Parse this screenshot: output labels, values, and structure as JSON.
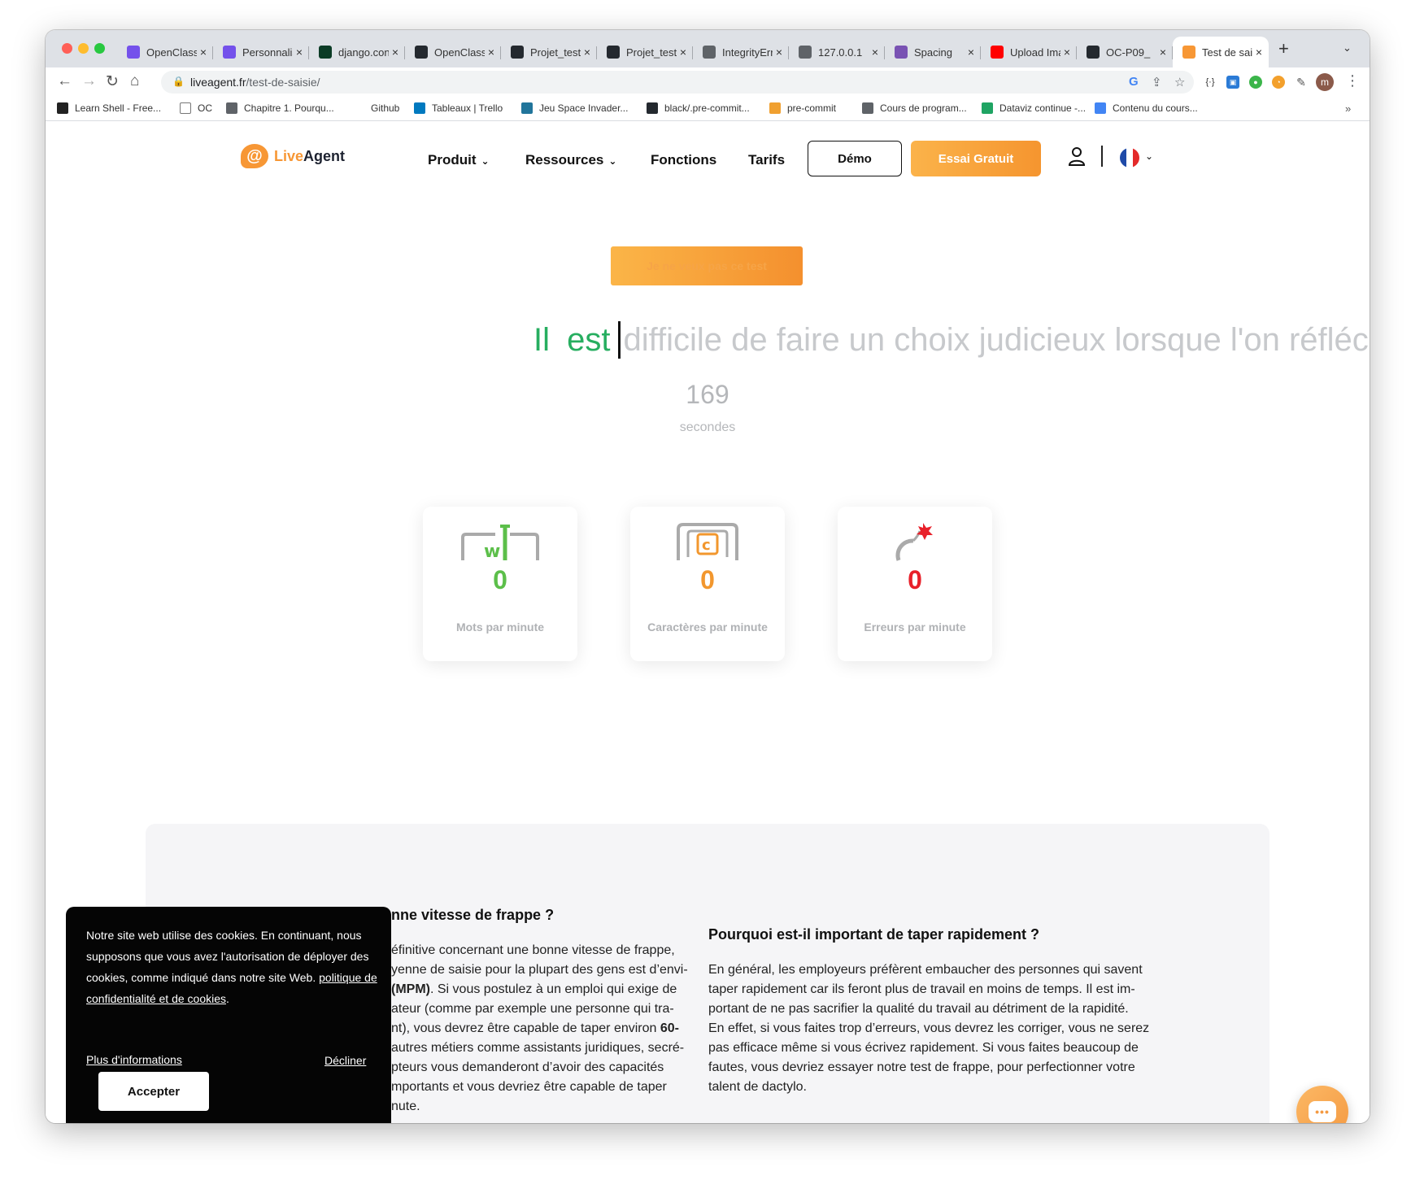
{
  "browser": {
    "tabs": [
      {
        "title": "OpenClassrooms",
        "favicon": "openclassrooms-icon",
        "color": "#7451eb"
      },
      {
        "title": "Personnalisation",
        "favicon": "openclassrooms-icon",
        "color": "#7451eb"
      },
      {
        "title": "django.contrib",
        "favicon": "django-icon",
        "color": "#0c3c26"
      },
      {
        "title": "OpenClassrooms",
        "favicon": "github-icon",
        "color": "#24292f"
      },
      {
        "title": "Projet_test",
        "favicon": "github-icon",
        "color": "#24292f"
      },
      {
        "title": "Projet_test",
        "favicon": "github-icon",
        "color": "#24292f"
      },
      {
        "title": "IntegrityError",
        "favicon": "globe-icon",
        "color": "#5f6368"
      },
      {
        "title": "127.0.0.1",
        "favicon": "globe-icon",
        "color": "#5f6368"
      },
      {
        "title": "Spacing",
        "favicon": "bootstrap-icon",
        "color": "#7952b3"
      },
      {
        "title": "Upload Images",
        "favicon": "youtube-icon",
        "color": "#ff0000"
      },
      {
        "title": "OC-P09_",
        "favicon": "github-icon",
        "color": "#24292f"
      },
      {
        "title": "Test de saisie",
        "favicon": "liveagent-icon",
        "color": "#f79735",
        "active": true
      }
    ],
    "url_host": "liveagent.fr",
    "url_path": "/test-de-saisie/",
    "avatar_initial": "m",
    "bookmarks": [
      {
        "label": "Learn Shell - Free...",
        "icon": "terminal-icon",
        "color": "#222"
      },
      {
        "label": "OC",
        "icon": "folder-icon",
        "color": "#fff"
      },
      {
        "label": "Chapitre 1. Pourqu...",
        "icon": "globe-icon",
        "color": "#5f6368"
      },
      {
        "label": "Github",
        "icon": "",
        "color": ""
      },
      {
        "label": "Tableaux | Trello",
        "icon": "trello-icon",
        "color": "#0079bf"
      },
      {
        "label": "Jeu Space Invader...",
        "icon": "wordpress-icon",
        "color": "#21759b"
      },
      {
        "label": "black/.pre-commit...",
        "icon": "github-icon",
        "color": "#24292f"
      },
      {
        "label": "pre-commit",
        "icon": "pre-commit-icon",
        "color": "#f0a030"
      },
      {
        "label": "Cours de program...",
        "icon": "globe-icon",
        "color": "#5f6368"
      },
      {
        "label": "Dataviz continue -...",
        "icon": "drive-icon",
        "color": "#1fa463"
      },
      {
        "label": "Contenu du cours...",
        "icon": "chrome-icon",
        "color": "#4285f4"
      }
    ]
  },
  "site": {
    "logo_live": "Live",
    "logo_agent": "Agent",
    "logo_mark": "@",
    "nav": {
      "produit": "Produit",
      "ressources": "Ressources",
      "fonctions": "Fonctions",
      "tarifs": "Tarifs",
      "demo": "Démo",
      "trial": "Essai Gratuit"
    },
    "colors": {
      "brand_orange": "#f79735",
      "typed_green": "#27ae60",
      "error_red": "#e8202a"
    }
  },
  "test": {
    "skip_button": "Je ne veux pas ce test",
    "typed_words": "Il est",
    "remaining_text": "difficile de faire un choix judicieux lorsque l'on réfléchit",
    "timer_value": "169",
    "timer_label": "secondes",
    "stats": [
      {
        "value": "0",
        "label": "Mots par minute",
        "icon": "wpm-keyboard-icon",
        "color": "#5cbf4a"
      },
      {
        "value": "0",
        "label": "Caractères par minute",
        "icon": "cpm-keyboard-icon",
        "color": "#f2972e"
      },
      {
        "value": "0",
        "label": "Erreurs par minute",
        "icon": "bomb-icon",
        "color": "#e8202a"
      }
    ]
  },
  "article": {
    "left_heading": "nne vitesse de frappe ?",
    "left_lines": [
      "éfinitive concernant une bonne vitesse de frappe,",
      "yenne de saisie pour la plupart des gens est d’envi-",
      "(MPM). Si vous postulez à un emploi qui exige de",
      "ateur (comme par exemple une personne qui tra-",
      "nt), vous devrez être capable de taper environ 60-",
      "autres métiers comme assistants juridiques, secré-",
      "pteurs vous demanderont d’avoir des capacités",
      "mportants et vous devriez être capable de taper",
      "nute."
    ],
    "right_heading": "Pourquoi est-il important de taper rapidement ?",
    "right_lines": [
      "En général, les employeurs préfèrent embaucher des personnes qui savent",
      "taper rapidement car ils feront plus de travail en moins de temps. Il est im-",
      "portant de ne pas sacrifier la qualité du travail au détriment de la rapidité.",
      "En effet, si vous faites trop d’erreurs, vous devrez les corriger, vous ne serez",
      "pas efficace même si vous écrivez rapidement. Si vous faites beaucoup de",
      "fautes, vous devriez essayer notre test de frappe, pour perfectionner votre",
      "talent de dactylo."
    ]
  },
  "cookie": {
    "text": "Notre site web utilise des cookies. En continuant, nous supposons que vous avez l'autorisation de dé­ployer des cookies, comme indiqué dans notre site Web.",
    "policy_link": "politique de confidentialité et de cookies",
    "more_info": "Plus d'informations",
    "decline": "Décliner",
    "accept": "Accepter"
  }
}
